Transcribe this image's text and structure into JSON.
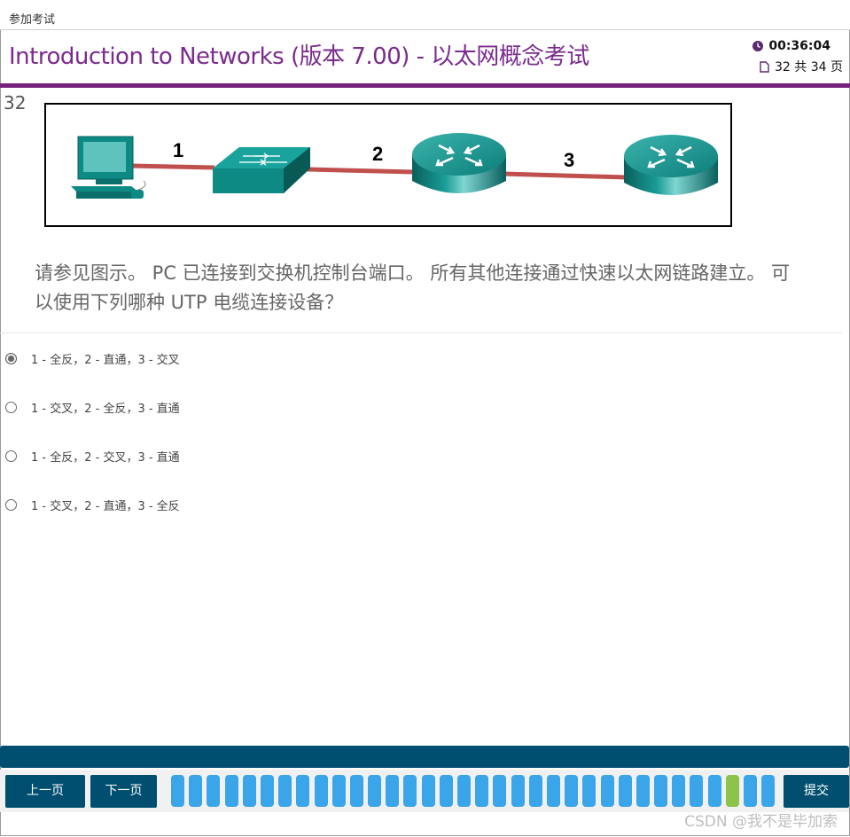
{
  "header": {
    "top_label": "参加考试",
    "title": "Introduction to Networks (版本 7.00) - 以太网概念考试",
    "timer": "00:36:04",
    "page_info": "32 共 34 页"
  },
  "question": {
    "number": "32",
    "text": "请参见图示。 PC 已连接到交换机控制台端口。 所有其他连接通过快速以太网链路建立。 可以使用下列哪种 UTP 电缆连接设备？",
    "exhibit": {
      "link_labels": [
        "1",
        "2",
        "3"
      ],
      "devices": [
        "pc",
        "switch",
        "router",
        "router"
      ]
    }
  },
  "options": [
    {
      "label": "1 - 全反，2 - 直通，3 - 交叉",
      "selected": true
    },
    {
      "label": "1 - 交叉，2 - 全反，3 - 直通",
      "selected": false
    },
    {
      "label": "1 - 全反，2 - 交叉，3 - 直通",
      "selected": false
    },
    {
      "label": "1 - 交叉，2 - 直通，3 - 全反",
      "selected": false
    }
  ],
  "footer": {
    "prev_label": "上一页",
    "next_label": "下一页",
    "submit_label": "提交",
    "total_pages": 34,
    "current_page": 32
  },
  "watermark": "CSDN @我不是毕加索",
  "colors": {
    "title": "#7b2b8e",
    "accent_line": "#76217e",
    "nav": "#004f71",
    "pager": "#3aa5e8",
    "pager_current": "#8cc34a"
  }
}
